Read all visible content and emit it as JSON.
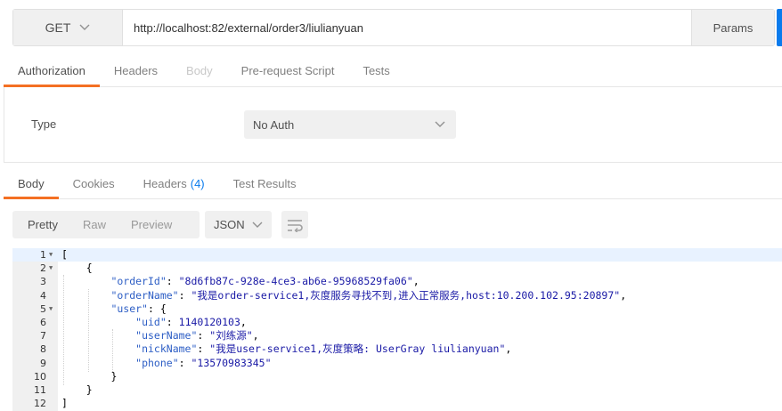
{
  "request": {
    "method": "GET",
    "url": "http://localhost:82/external/order3/liulianyuan",
    "params_label": "Params"
  },
  "request_tabs": [
    {
      "label": "Authorization",
      "state": "active"
    },
    {
      "label": "Headers",
      "state": "normal"
    },
    {
      "label": "Body",
      "state": "disabled"
    },
    {
      "label": "Pre-request Script",
      "state": "normal"
    },
    {
      "label": "Tests",
      "state": "normal"
    }
  ],
  "auth": {
    "type_label": "Type",
    "type_value": "No Auth"
  },
  "response_tabs": [
    {
      "label": "Body",
      "count": "",
      "state": "active"
    },
    {
      "label": "Cookies",
      "count": "",
      "state": "normal"
    },
    {
      "label": "Headers",
      "count": "(4)",
      "state": "normal"
    },
    {
      "label": "Test Results",
      "count": "",
      "state": "normal"
    }
  ],
  "format": {
    "options": [
      "Pretty",
      "Raw",
      "Preview"
    ],
    "active": "Pretty",
    "language": "JSON"
  },
  "code_lines": [
    {
      "n": "1",
      "fold": true,
      "indent": 0,
      "parts": [
        [
          "p",
          "["
        ]
      ]
    },
    {
      "n": "2",
      "fold": true,
      "indent": 1,
      "parts": [
        [
          "p",
          "{"
        ]
      ]
    },
    {
      "n": "3",
      "fold": false,
      "indent": 2,
      "parts": [
        [
          "k",
          "\"orderId\""
        ],
        [
          "p",
          ": "
        ],
        [
          "s",
          "\"8d6fb87c-928e-4ce3-ab6e-95968529fa06\""
        ],
        [
          "p",
          ","
        ]
      ]
    },
    {
      "n": "4",
      "fold": false,
      "indent": 2,
      "parts": [
        [
          "k",
          "\"orderName\""
        ],
        [
          "p",
          ": "
        ],
        [
          "s",
          "\"我是order-service1,灰度服务寻找不到,进入正常服务,host:10.200.102.95:20897\""
        ],
        [
          "p",
          ","
        ]
      ]
    },
    {
      "n": "5",
      "fold": true,
      "indent": 2,
      "parts": [
        [
          "k",
          "\"user\""
        ],
        [
          "p",
          ": {"
        ]
      ]
    },
    {
      "n": "6",
      "fold": false,
      "indent": 3,
      "parts": [
        [
          "k",
          "\"uid\""
        ],
        [
          "p",
          ": "
        ],
        [
          "n",
          "1140120103"
        ],
        [
          "p",
          ","
        ]
      ]
    },
    {
      "n": "7",
      "fold": false,
      "indent": 3,
      "parts": [
        [
          "k",
          "\"userName\""
        ],
        [
          "p",
          ": "
        ],
        [
          "s",
          "\"刘练源\""
        ],
        [
          "p",
          ","
        ]
      ]
    },
    {
      "n": "8",
      "fold": false,
      "indent": 3,
      "parts": [
        [
          "k",
          "\"nickName\""
        ],
        [
          "p",
          ": "
        ],
        [
          "s",
          "\"我是user-service1,灰度策略: UserGray liulianyuan\""
        ],
        [
          "p",
          ","
        ]
      ]
    },
    {
      "n": "9",
      "fold": false,
      "indent": 3,
      "parts": [
        [
          "k",
          "\"phone\""
        ],
        [
          "p",
          ": "
        ],
        [
          "s",
          "\"13570983345\""
        ]
      ]
    },
    {
      "n": "10",
      "fold": false,
      "indent": 2,
      "parts": [
        [
          "p",
          "}"
        ]
      ]
    },
    {
      "n": "11",
      "fold": false,
      "indent": 1,
      "parts": [
        [
          "p",
          "}"
        ]
      ]
    },
    {
      "n": "12",
      "fold": false,
      "indent": 0,
      "parts": [
        [
          "p",
          "]"
        ]
      ]
    }
  ],
  "colors": {
    "active_tab_underline": "#f47023",
    "accent_blue": "#097bed",
    "json_key": "#2d5ec5",
    "json_string": "#1a1aa6"
  }
}
